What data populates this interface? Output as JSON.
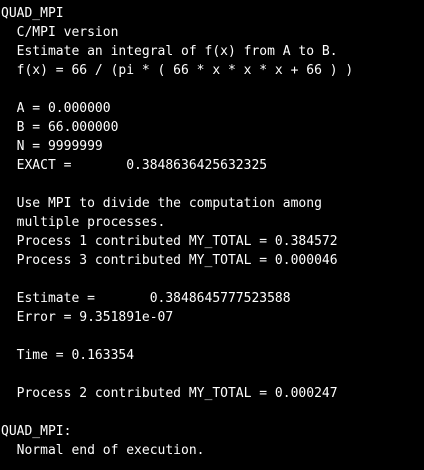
{
  "terminal": {
    "background": "#000000",
    "foreground": "#ffffff",
    "lines": [
      "QUAD_MPI",
      "  C/MPI version",
      "  Estimate an integral of f(x) from A to B.",
      "  f(x) = 66 / (pi * ( 66 * x * x * x + 66 ) )",
      "",
      "  A = 0.000000",
      "  B = 66.000000",
      "  N = 9999999",
      "  EXACT =       0.3848636425632325",
      "",
      "  Use MPI to divide the computation among",
      "  multiple processes.",
      "  Process 1 contributed MY_TOTAL = 0.384572",
      "  Process 3 contributed MY_TOTAL = 0.000046",
      "",
      "  Estimate =       0.3848645777523588",
      "  Error = 9.351891e-07",
      "",
      "  Time = 0.163354",
      "",
      "  Process 2 contributed MY_TOTAL = 0.000247",
      "",
      "QUAD_MPI:",
      "  Normal end of execution."
    ]
  }
}
